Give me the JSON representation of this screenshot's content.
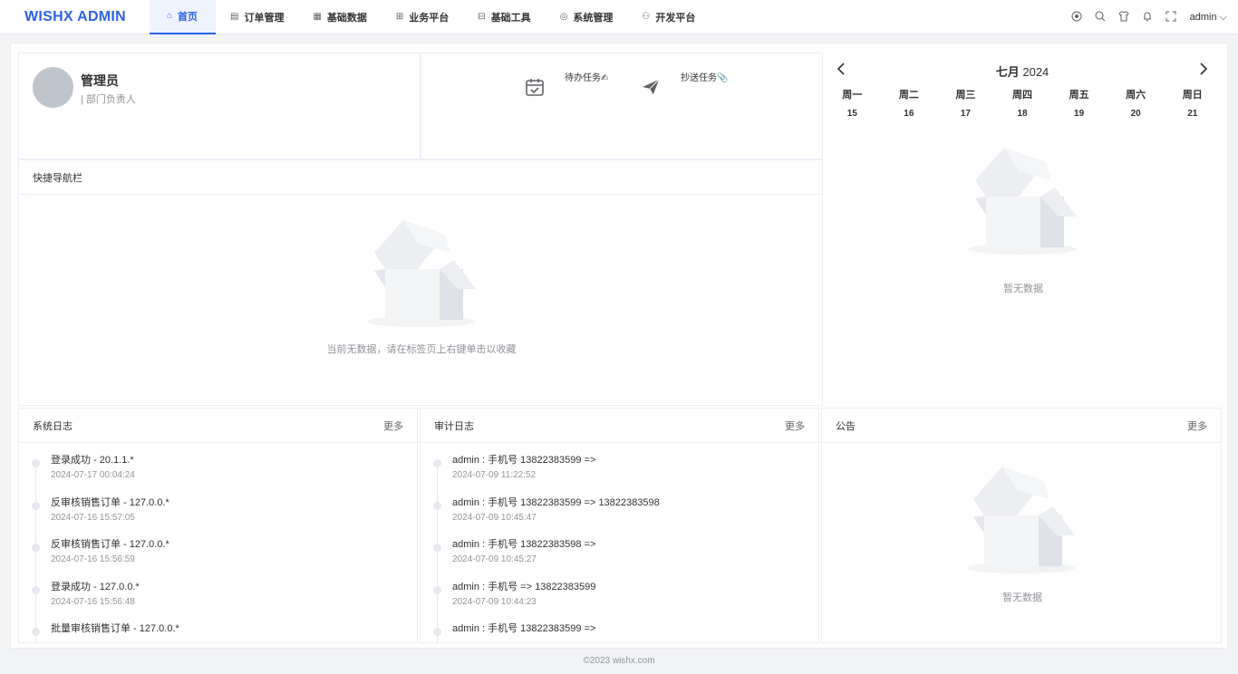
{
  "header": {
    "logo": "WISHX ADMIN",
    "nav": [
      {
        "icon": "⌂",
        "label": "首页",
        "active": true
      },
      {
        "icon": "▤",
        "label": "订单管理"
      },
      {
        "icon": "▦",
        "label": "基础数据"
      },
      {
        "icon": "⊞",
        "label": "业务平台"
      },
      {
        "icon": "⊟",
        "label": "基础工具"
      },
      {
        "icon": "◎",
        "label": "系统管理"
      },
      {
        "icon": "⚇",
        "label": "开发平台"
      }
    ],
    "user": "admin ⌵"
  },
  "profile": {
    "name": "管理员",
    "role": "| 部门负责人"
  },
  "tasks": {
    "todo_label": "待办任务✍",
    "cc_label": "抄送任务📎"
  },
  "quicknav": {
    "title": "快捷导航栏",
    "empty": "当前无数据，请在标签页上右键单击以收藏"
  },
  "calendar": {
    "month": "七月",
    "year": "2024",
    "weekdays": [
      "周一",
      "周二",
      "周三",
      "周四",
      "周五",
      "周六",
      "周日"
    ],
    "days": [
      "15",
      "16",
      "17",
      "18",
      "19",
      "20",
      "21"
    ],
    "empty": "暂无数据"
  },
  "syslog": {
    "title": "系统日志",
    "more": "更多",
    "items": [
      {
        "text": "登录成功 - 20.1.1.*",
        "time": "2024-07-17 00:04:24"
      },
      {
        "text": "反审核销售订单 - 127.0.0.*",
        "time": "2024-07-16 15:57:05"
      },
      {
        "text": "反审核销售订单 - 127.0.0.*",
        "time": "2024-07-16 15:56:59"
      },
      {
        "text": "登录成功 - 127.0.0.*",
        "time": "2024-07-16 15:56:48"
      },
      {
        "text": "批量审核销售订单 - 127.0.0.*",
        "time": ""
      }
    ]
  },
  "auditlog": {
    "title": "审计日志",
    "more": "更多",
    "items": [
      {
        "text": "admin : 手机号 13822383599 =>",
        "time": "2024-07-09 11:22:52"
      },
      {
        "text": "admin : 手机号 13822383599 => 13822383598",
        "time": "2024-07-09 10:45:47"
      },
      {
        "text": "admin : 手机号 13822383598 =>",
        "time": "2024-07-09 10:45:27"
      },
      {
        "text": "admin : 手机号 => 13822383599",
        "time": "2024-07-09 10:44:23"
      },
      {
        "text": "admin : 手机号 13822383599 =>",
        "time": ""
      }
    ]
  },
  "notice": {
    "title": "公告",
    "more": "更多",
    "empty": "暂无数据"
  },
  "footer": "©2023 wishx.com"
}
